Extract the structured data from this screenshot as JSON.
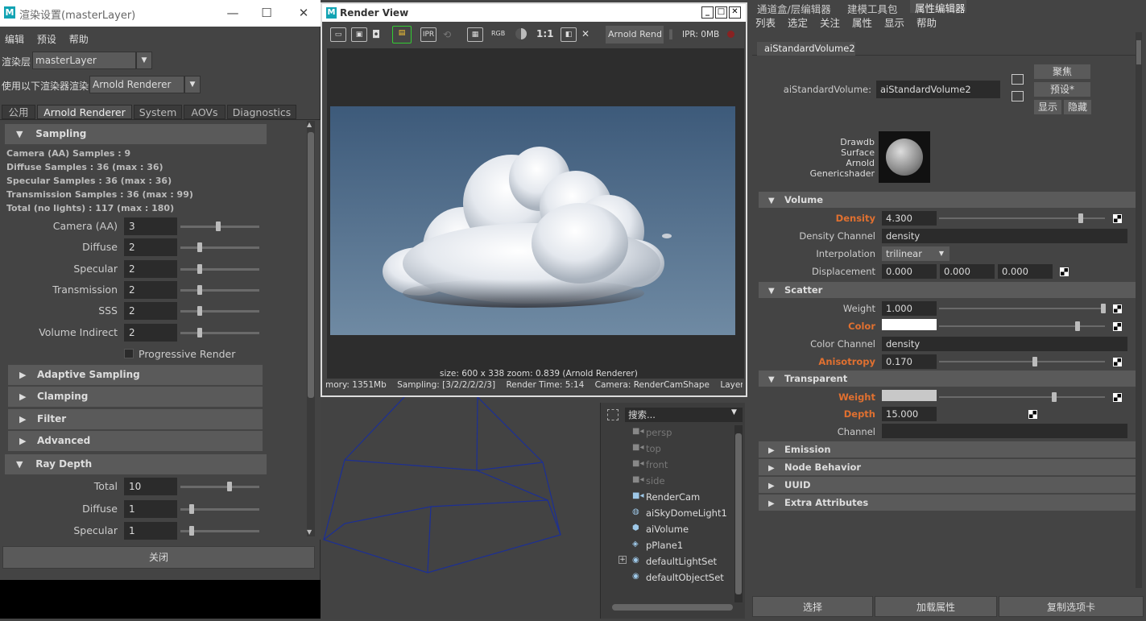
{
  "render_settings": {
    "title": "渲染设置(masterLayer)",
    "menu": [
      "编辑",
      "预设",
      "帮助"
    ],
    "layer_label": "渲染层",
    "layer_value": "masterLayer",
    "renderer_label": "使用以下渲染器渲染",
    "renderer_value": "Arnold Renderer",
    "tabs": [
      "公用",
      "Arnold Renderer",
      "System",
      "AOVs",
      "Diagnostics"
    ],
    "sampling_header": "Sampling",
    "info_lines": [
      "Camera (AA) Samples : 9",
      "Diffuse Samples : 36 (max : 36)",
      "Specular Samples : 36 (max : 36)",
      "Transmission Samples : 36 (max : 99)",
      "Total (no lights) : 117 (max : 180)"
    ],
    "sampling_rows": [
      {
        "label": "Camera (AA)",
        "value": "3",
        "slider": 0.45
      },
      {
        "label": "Diffuse",
        "value": "2",
        "slider": 0.2
      },
      {
        "label": "Specular",
        "value": "2",
        "slider": 0.2
      },
      {
        "label": "Transmission",
        "value": "2",
        "slider": 0.2
      },
      {
        "label": "SSS",
        "value": "2",
        "slider": 0.2
      },
      {
        "label": "Volume Indirect",
        "value": "2",
        "slider": 0.2
      }
    ],
    "progressive_label": "Progressive Render",
    "collapsed_sections": [
      "Adaptive Sampling",
      "Clamping",
      "Filter",
      "Advanced"
    ],
    "ray_depth_header": "Ray Depth",
    "ray_rows": [
      {
        "label": "Total",
        "value": "10",
        "slider": 0.6
      },
      {
        "label": "Diffuse",
        "value": "1",
        "slider": 0.1
      },
      {
        "label": "Specular",
        "value": "1",
        "slider": 0.1
      }
    ],
    "close_label": "关闭"
  },
  "render_view": {
    "title": "Render View",
    "renderer_button": "Arnold Rend",
    "ratio_label": "1:1",
    "rgb_label": "RGB",
    "ipr_label": "IPR: 0MB",
    "info_line": "size: 600 x 338 zoom: 0.839     (Arnold Renderer)",
    "status": {
      "memory": "mory: 1351Mb",
      "sampling": "Sampling: [3/2/2/2/2/3]",
      "time": "Render Time: 5:14",
      "camera": "Camera: RenderCamShape",
      "layer": "Layer: Volume_"
    }
  },
  "outliner": {
    "search_placeholder": "搜索...",
    "items": [
      {
        "label": "persp",
        "icon": "camera-icon",
        "dim": true
      },
      {
        "label": "top",
        "icon": "camera-icon",
        "dim": true
      },
      {
        "label": "front",
        "icon": "camera-icon",
        "dim": true
      },
      {
        "label": "side",
        "icon": "camera-icon",
        "dim": true
      },
      {
        "label": "RenderCam",
        "icon": "camera-icon",
        "dim": false
      },
      {
        "label": "aiSkyDomeLight1",
        "icon": "skydome-icon",
        "dim": false
      },
      {
        "label": "aiVolume",
        "icon": "volume-cube-icon",
        "dim": false
      },
      {
        "label": "pPlane1",
        "icon": "plane-icon",
        "dim": false
      },
      {
        "label": "defaultLightSet",
        "icon": "set-icon",
        "dim": false
      },
      {
        "label": "defaultObjectSet",
        "icon": "set-icon",
        "dim": false
      }
    ]
  },
  "attribute_editor": {
    "top_tabs": [
      "通道盒/层编辑器",
      "建模工具包",
      "属性编辑器"
    ],
    "menu": [
      "列表",
      "选定",
      "关注",
      "属性",
      "显示",
      "帮助"
    ],
    "node_tab": "aiStandardVolume2",
    "node_label": "aiStandardVolume:",
    "node_value": "aiStandardVolume2",
    "btn_focus": "聚焦",
    "btn_preset": "预设*",
    "btn_show": "显示",
    "btn_hide": "隐藏",
    "swatch_lines": [
      "Drawdb",
      "Surface",
      "Arnold",
      "Genericshader"
    ],
    "volume_header": "Volume",
    "density_label": "Density",
    "density_value": "4.300",
    "density_slider": 0.86,
    "density_channel_label": "Density Channel",
    "density_channel_value": "density",
    "interpolation_label": "Interpolation",
    "interpolation_value": "trilinear",
    "displacement_label": "Displacement",
    "displacement_values": [
      "0.000",
      "0.000",
      "0.000"
    ],
    "scatter_header": "Scatter",
    "weight_label": "Weight",
    "weight_value": "1.000",
    "weight_slider": 1.0,
    "color_label": "Color",
    "color_value": "#ffffff",
    "color_slider": 0.84,
    "color_channel_label": "Color Channel",
    "color_channel_value": "density",
    "anisotropy_label": "Anisotropy",
    "anisotropy_value": "0.170",
    "anisotropy_slider": 0.58,
    "transparent_header": "Transparent",
    "t_weight_label": "Weight",
    "t_weight_color": "#c8c8c8",
    "t_weight_slider": 0.7,
    "depth_label": "Depth",
    "depth_value": "15.000",
    "channel_label": "Channel",
    "channel_value": "",
    "collapsed_sections": [
      "Emission",
      "Node Behavior",
      "UUID",
      "Extra Attributes"
    ],
    "bottom_buttons": [
      "选择",
      "加载属性",
      "复制选项卡"
    ]
  },
  "colors": {
    "accent_orange": "#e07030",
    "maya_logo": "#12a3b3",
    "sky_top": "#3d5a7a",
    "sky_bottom": "#6f8aa3",
    "wire": "#1c2f95"
  }
}
